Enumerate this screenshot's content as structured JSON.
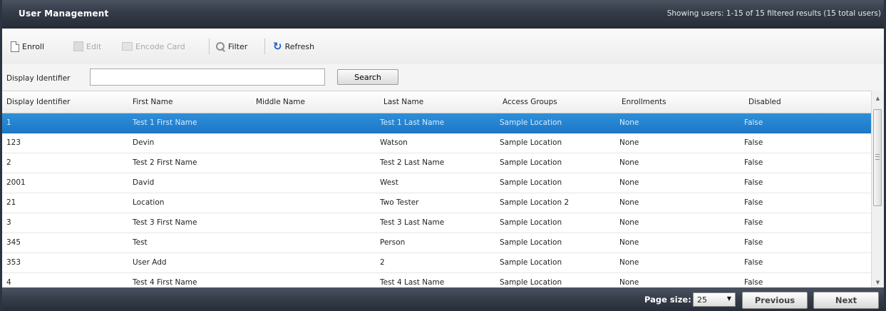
{
  "header": {
    "title": "User Management",
    "status": "Showing users: 1-15 of 15 filtered results (15 total users)"
  },
  "toolbar": {
    "enroll": "Enroll",
    "edit": "Edit",
    "encode_card": "Encode Card",
    "filter": "Filter",
    "refresh": "Refresh"
  },
  "search": {
    "label": "Display Identifier",
    "value": "",
    "button": "Search"
  },
  "table": {
    "columns": [
      "Display Identifier",
      "First Name",
      "Middle Name",
      "Last Name",
      "Access Groups",
      "Enrollments",
      "Disabled"
    ],
    "rows": [
      [
        "1",
        "Test 1 First Name",
        "",
        "Test 1 Last Name",
        "Sample Location",
        "None",
        "False"
      ],
      [
        "123",
        "Devin",
        "",
        "Watson",
        "Sample Location",
        "None",
        "False"
      ],
      [
        "2",
        "Test 2 First Name",
        "",
        "Test 2 Last Name",
        "Sample Location",
        "None",
        "False"
      ],
      [
        "2001",
        "David",
        "",
        "West",
        "Sample Location",
        "None",
        "False"
      ],
      [
        "21",
        "Location",
        "",
        "Two Tester",
        "Sample Location 2",
        "None",
        "False"
      ],
      [
        "3",
        "Test 3 First Name",
        "",
        "Test 3 Last Name",
        "Sample Location",
        "None",
        "False"
      ],
      [
        "345",
        "Test",
        "",
        "Person",
        "Sample Location",
        "None",
        "False"
      ],
      [
        "353",
        "User Add",
        "",
        "2",
        "Sample Location",
        "None",
        "False"
      ],
      [
        "4",
        "Test 4 First Name",
        "",
        "Test 4 Last Name",
        "Sample Location",
        "None",
        "False"
      ]
    ],
    "selected_row": 0
  },
  "footer": {
    "page_size_label": "Page size:",
    "page_size": "25",
    "previous": "Previous",
    "next": "Next"
  },
  "icons": {
    "enroll": "new-document-icon",
    "edit": "edit-icon",
    "encode_card": "card-icon",
    "filter": "magnifier-icon",
    "refresh": "refresh-icon"
  },
  "colors": {
    "selected_row": "#2484d0",
    "header_bar": "#343b47",
    "refresh_icon": "#1e5fc9"
  }
}
